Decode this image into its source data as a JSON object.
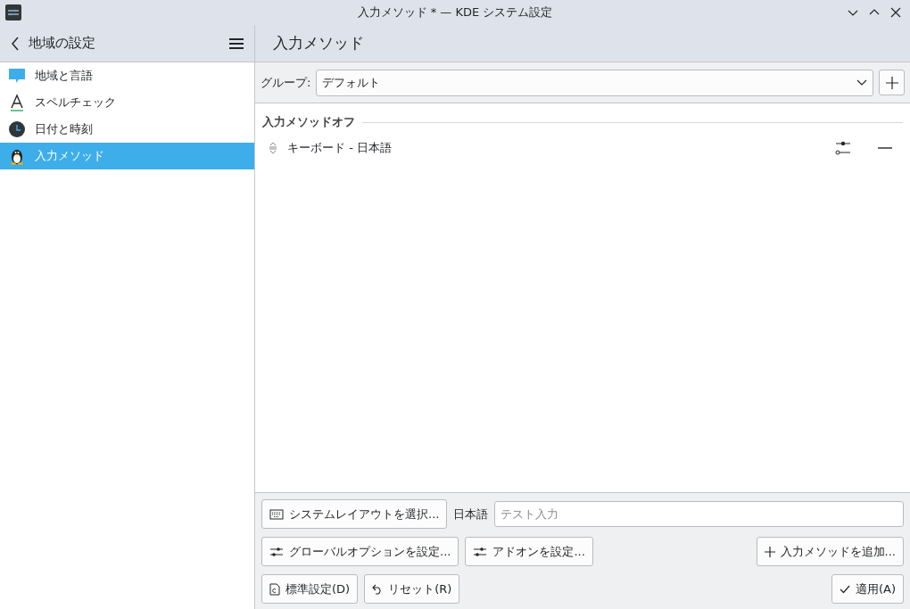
{
  "window": {
    "title": "入力メソッド * — KDE システム設定"
  },
  "sidebar": {
    "back_title": "地域の設定",
    "items": [
      {
        "label": "地域と言語",
        "selected": false
      },
      {
        "label": "スペルチェック",
        "selected": false
      },
      {
        "label": "日付と時刻",
        "selected": false
      },
      {
        "label": "入力メソッド",
        "selected": true
      }
    ]
  },
  "page": {
    "title": "入力メソッド",
    "group": {
      "label": "グループ:",
      "value": "デフォルト"
    },
    "section_title": "入力メソッドオフ",
    "methods": [
      {
        "name": "キーボード - 日本語"
      }
    ],
    "bottom": {
      "layout_button": "システムレイアウトを選択...",
      "test_label": "日本語",
      "test_placeholder": "テスト入力",
      "global_button": "グローバルオプションを設定...",
      "addon_button": "アドオンを設定...",
      "add_button": "入力メソッドを追加...",
      "defaults_button": "標準設定(D)",
      "reset_button": "リセット(R)",
      "apply_button": "適用(A)"
    }
  }
}
